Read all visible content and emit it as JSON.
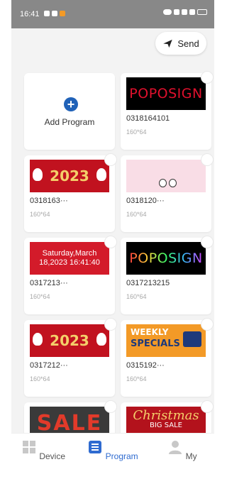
{
  "status_bar": {
    "time": "16:41"
  },
  "header": {
    "send_label": "Send"
  },
  "add_program": {
    "label": "Add Program"
  },
  "programs": [
    {
      "title": "0318164101",
      "resolution": "160*64",
      "thumb_text": "POPOSIGN"
    },
    {
      "title": "0318163···",
      "resolution": "160*64",
      "thumb_text": "2023"
    },
    {
      "title": "0318120···",
      "resolution": "160*64"
    },
    {
      "title": "0317213···",
      "resolution": "160*64",
      "thumb_text": "Saturday,March 18,2023 16:41:40"
    },
    {
      "title": "0317213215",
      "resolution": "160*64",
      "thumb_text": "POPOSIGN"
    },
    {
      "title": "0317212···",
      "resolution": "160*64",
      "thumb_text": "2023"
    },
    {
      "title": "0315192···",
      "resolution": "160*64",
      "thumb_text_1": "WEEKLY",
      "thumb_text_2": "SPECIALS"
    },
    {
      "thumb_text": "SALE"
    },
    {
      "thumb_text": "Christmas",
      "thumb_text_2": "BIG SALE"
    }
  ],
  "bottom_nav": [
    {
      "label": "Device",
      "icon": "grid-icon"
    },
    {
      "label": "Program",
      "icon": "list-icon",
      "active": true
    },
    {
      "label": "My",
      "icon": "person-icon"
    }
  ],
  "colors": {
    "accent": "#2f6bd0",
    "add_button": "#2062b8"
  }
}
